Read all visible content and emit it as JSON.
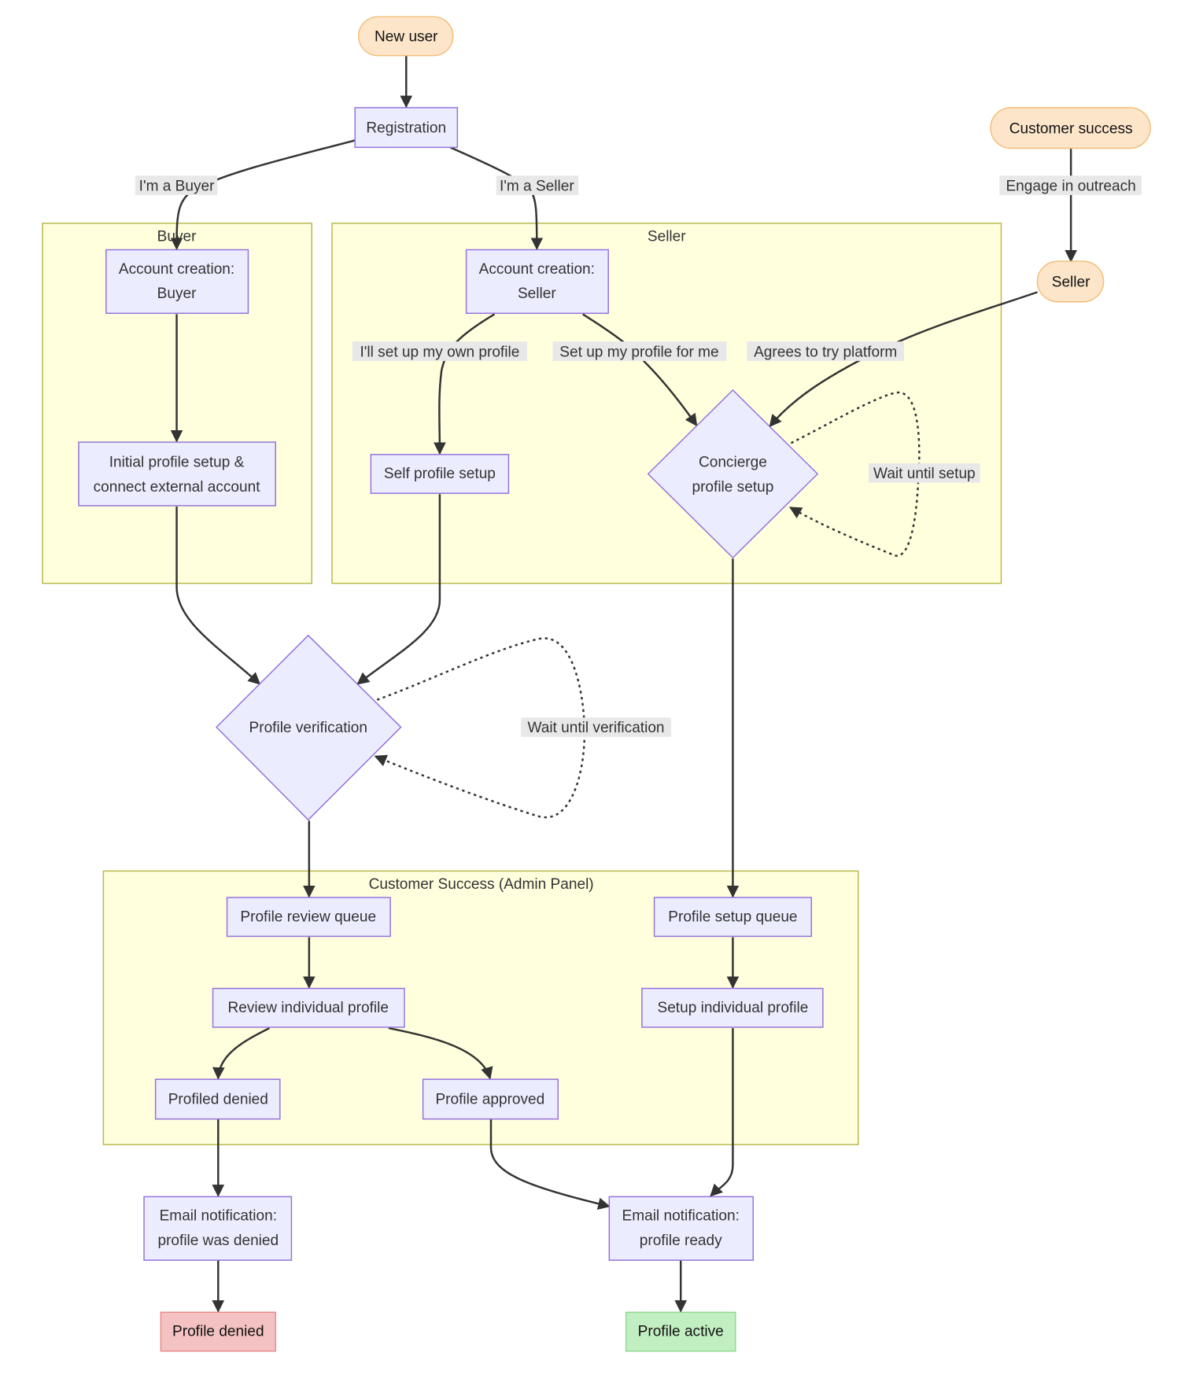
{
  "diagram": {
    "type": "flowchart",
    "clusters": {
      "buyer": "Buyer",
      "seller": "Seller",
      "admin": "Customer Success (Admin Panel)"
    },
    "nodes": {
      "new_user": "New user",
      "registration": "Registration",
      "customer_success": "Customer success",
      "seller_start": "Seller",
      "acct_buyer_1": "Account creation:",
      "acct_buyer_2": "Buyer",
      "initial_setup_1": "Initial profile setup &",
      "initial_setup_2": "connect external account",
      "acct_seller_1": "Account creation:",
      "acct_seller_2": "Seller",
      "self_setup": "Self profile setup",
      "concierge_1": "Concierge",
      "concierge_2": "profile setup",
      "verification": "Profile verification",
      "review_queue": "Profile review queue",
      "review_individual": "Review individual profile",
      "profiled_denied": "Profiled denied",
      "profile_approved": "Profile approved",
      "setup_queue": "Profile setup queue",
      "setup_individual": "Setup individual profile",
      "email_denied_1": "Email notification:",
      "email_denied_2": "profile was denied",
      "email_ready_1": "Email notification:",
      "email_ready_2": "profile ready",
      "profile_denied": "Profile denied",
      "profile_active": "Profile active"
    },
    "edge_labels": {
      "buyer": "I'm a Buyer",
      "seller": "I'm a Seller",
      "outreach": "Engage in outreach",
      "own_profile": "I'll set up my own profile",
      "for_me": "Set up my profile for me",
      "agrees": "Agrees to try platform",
      "wait_setup": "Wait until setup",
      "wait_verification": "Wait until verification"
    },
    "colors": {
      "node_fill": "#ececff",
      "node_stroke": "#9370db",
      "terminal_fill": "#fce5c9",
      "cluster_fill": "#ffffde",
      "denied_fill": "#f4c2c2",
      "active_fill": "#c2efc2",
      "edge": "#333333"
    }
  }
}
